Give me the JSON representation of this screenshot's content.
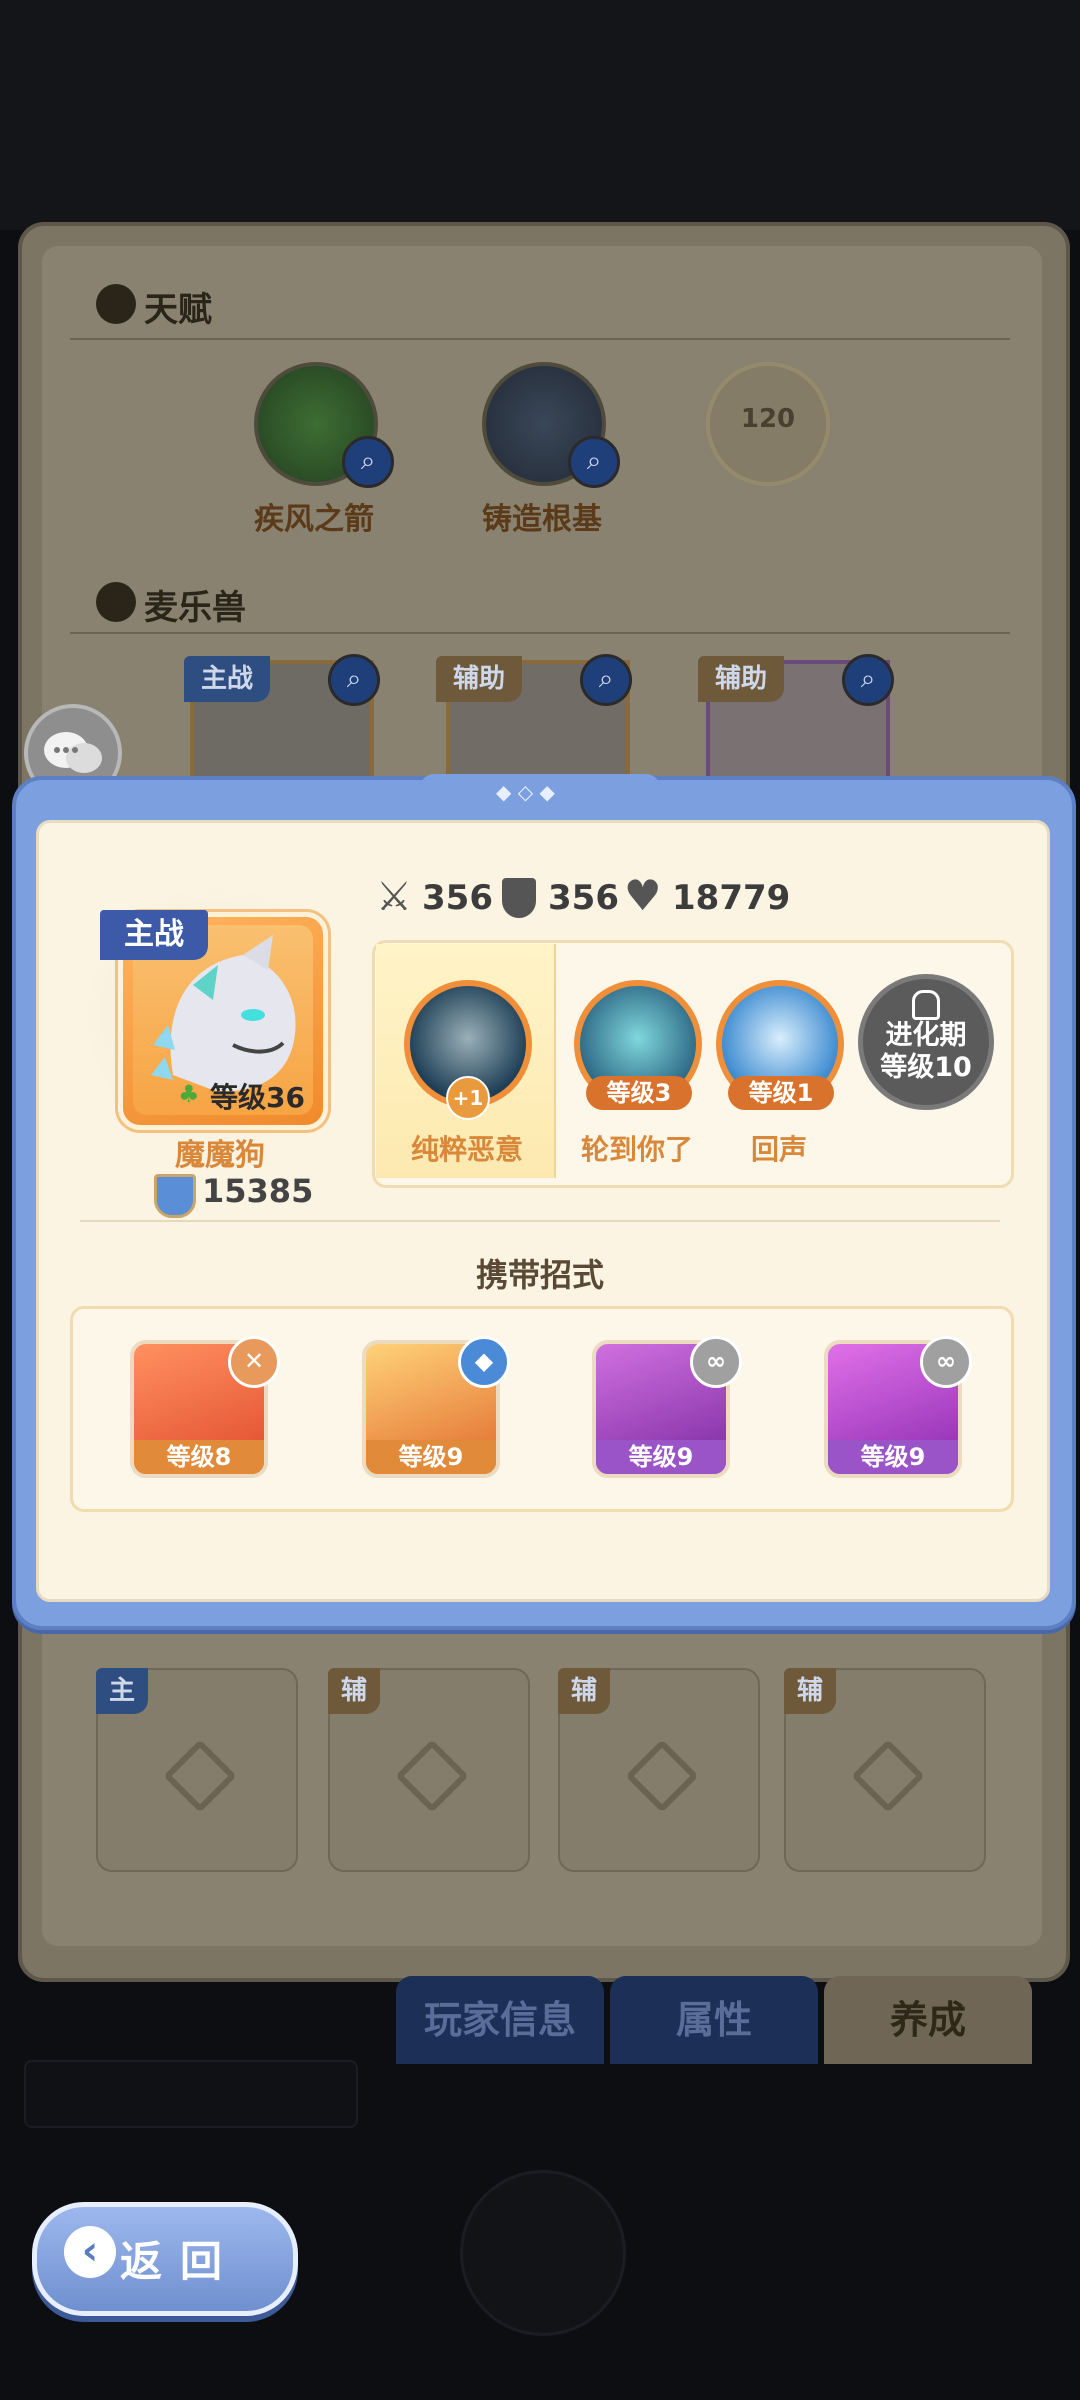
{
  "background": {
    "talent_title": "天赋",
    "talents": [
      {
        "label": "疾风之箭"
      },
      {
        "label": "铸造根基"
      },
      {
        "label": "120"
      }
    ],
    "pets_title": "麦乐兽",
    "pet_slots": [
      {
        "tag": "主战"
      },
      {
        "tag": "辅助"
      },
      {
        "tag": "辅助"
      }
    ],
    "formation_tags": [
      "主",
      "辅",
      "辅",
      "辅"
    ],
    "tabs": [
      {
        "label": "玩家信息"
      },
      {
        "label": "属性"
      },
      {
        "label": "养成"
      }
    ]
  },
  "pet_detail": {
    "role_badge": "主战",
    "level_text": "等级36",
    "name": "魔魔狗",
    "power": "15385",
    "stats": {
      "attack": "356",
      "defense": "356",
      "hp": "18779"
    },
    "skills": [
      {
        "name": "纯粹恶意",
        "badge": "+1"
      },
      {
        "name": "轮到你了",
        "level": "等级3"
      },
      {
        "name": "回声",
        "level": "等级1"
      }
    ],
    "locked_line1": "进化期",
    "locked_line2": "等级10",
    "moves_title": "携带招式",
    "moves": [
      {
        "level": "等级8"
      },
      {
        "level": "等级9"
      },
      {
        "level": "等级9"
      },
      {
        "level": "等级9"
      }
    ]
  },
  "back_button": "返回"
}
